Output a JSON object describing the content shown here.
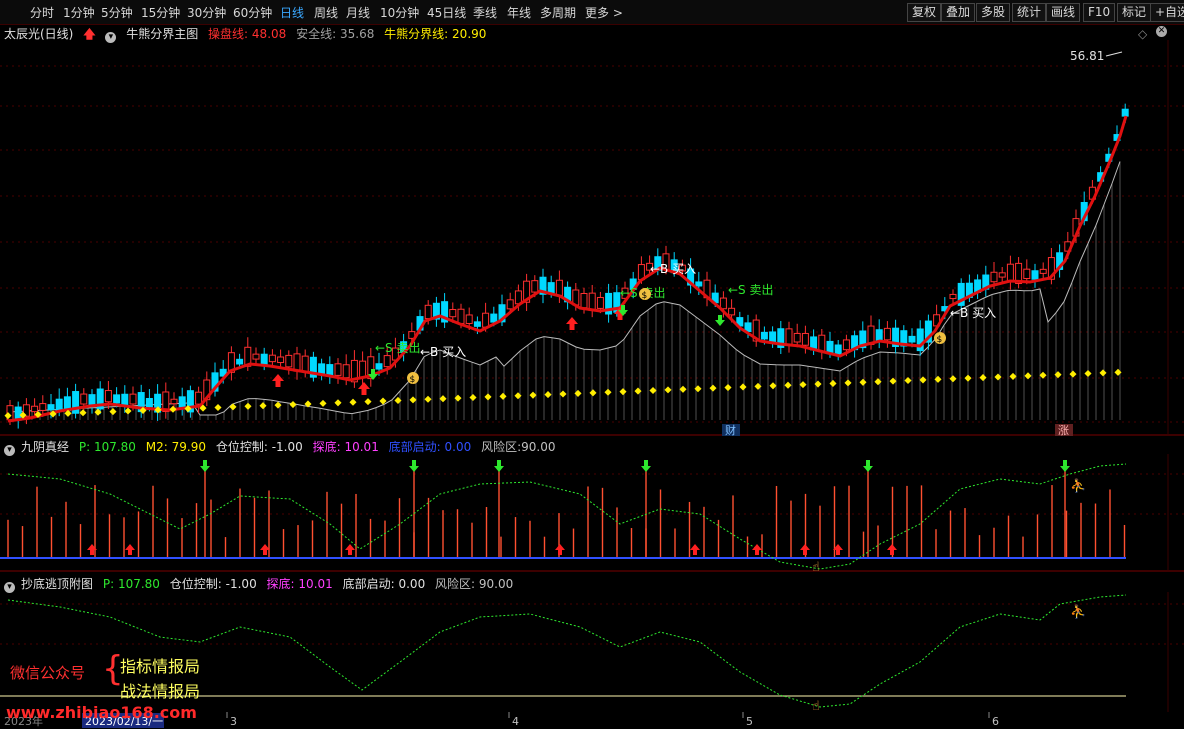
{
  "toolbar": {
    "periods": [
      "分时",
      "1分钟",
      "5分钟",
      "15分钟",
      "30分钟",
      "60分钟",
      "日线",
      "周线",
      "月线",
      "10分钟",
      "45日线",
      "季线",
      "年线",
      "多周期",
      "更多 >"
    ],
    "active_period": "日线",
    "right_buttons": [
      "复权",
      "叠加",
      "多股",
      "统计",
      "画线",
      "F10",
      "标记",
      "+自选"
    ]
  },
  "main_panel": {
    "stock_title": "太辰光(日线)",
    "indicator_name": "牛熊分界主图",
    "caopan_label": "操盘线:",
    "caopan_value": "48.08",
    "anquan_label": "安全线:",
    "anquan_value": "35.68",
    "niuxiong_label": "牛熊分界线:",
    "niuxiong_value": "20.90",
    "high_price": "56.81",
    "markers": {
      "buy1": "B 买入",
      "sell1": "S 卖出",
      "buy2": "B 买入",
      "buy3": "B 买入",
      "sell2": "S 卖出",
      "buy4": "B 买入",
      "sell3": "S 卖出",
      "cai": "财",
      "zhang": "涨"
    }
  },
  "panel2": {
    "name": "九阴真经",
    "p_label": "P:",
    "p_value": "107.80",
    "m2_label": "M2:",
    "m2_value": "79.90",
    "cangwei_label": "仓位控制:",
    "cangwei_value": "-1.00",
    "tandi_label": "探底:",
    "tandi_value": "10.01",
    "dibu_label": "底部启动:",
    "dibu_value": "0.00",
    "fengxian_label": "风险区:",
    "fengxian_value": "90.00"
  },
  "panel3": {
    "name": "抄底逃顶附图",
    "p_label": "P:",
    "p_value": "107.80",
    "cangwei_label": "仓位控制:",
    "cangwei_value": "-1.00",
    "tandi_label": "探底:",
    "tandi_value": "10.01",
    "dibu_label": "底部启动:",
    "dibu_value": "0.00",
    "fengxian_label": "风险区:",
    "fengxian_value": "90.00"
  },
  "watermark": {
    "wechat": "微信公众号",
    "line1": "指标情报局",
    "line2": "战法情报局",
    "website": "www.zhibiao168.com"
  },
  "date_axis": {
    "year": "2023年",
    "cursor_date": "2023/02/13/一",
    "months": [
      "3",
      "4",
      "5",
      "6"
    ]
  },
  "colors": {
    "bull": "#ff3030",
    "bear": "#00d8ff",
    "caopan_line": "#e01010",
    "safety_dots": "#ffee00",
    "panel_bg": "#000000",
    "active_tab": "#3aa8ff"
  }
}
